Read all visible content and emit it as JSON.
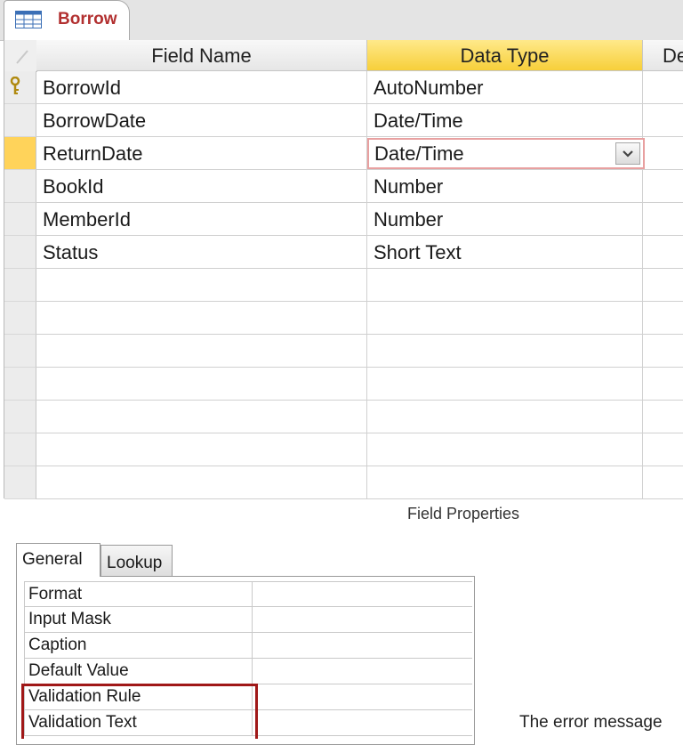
{
  "tab": {
    "label": "Borrow"
  },
  "grid": {
    "headers": [
      "Field Name",
      "Data Type",
      "De"
    ],
    "rows": [
      {
        "field": "BorrowId",
        "type": "AutoNumber",
        "primary_key": true
      },
      {
        "field": "BorrowDate",
        "type": "Date/Time"
      },
      {
        "field": "ReturnDate",
        "type": "Date/Time",
        "current": true
      },
      {
        "field": "BookId",
        "type": "Number"
      },
      {
        "field": "MemberId",
        "type": "Number"
      },
      {
        "field": "Status",
        "type": "Short Text"
      }
    ]
  },
  "field_properties": {
    "title": "Field Properties",
    "tabs": [
      "General",
      "Lookup"
    ],
    "active_tab": "General",
    "properties": [
      "Format",
      "Input Mask",
      "Caption",
      "Default Value",
      "Validation Rule",
      "Validation Text"
    ],
    "help_text": "The error message"
  },
  "colors": {
    "tab_label": "#b23030",
    "active_header": "#f7cf3a",
    "current_row_selector": "#ffd35a",
    "highlight_box": "#a01818",
    "editing_border": "#e8a0a0"
  },
  "icons": {
    "tab": "table-icon",
    "primary_key": "key-icon",
    "dropdown": "chevron-down-icon"
  }
}
